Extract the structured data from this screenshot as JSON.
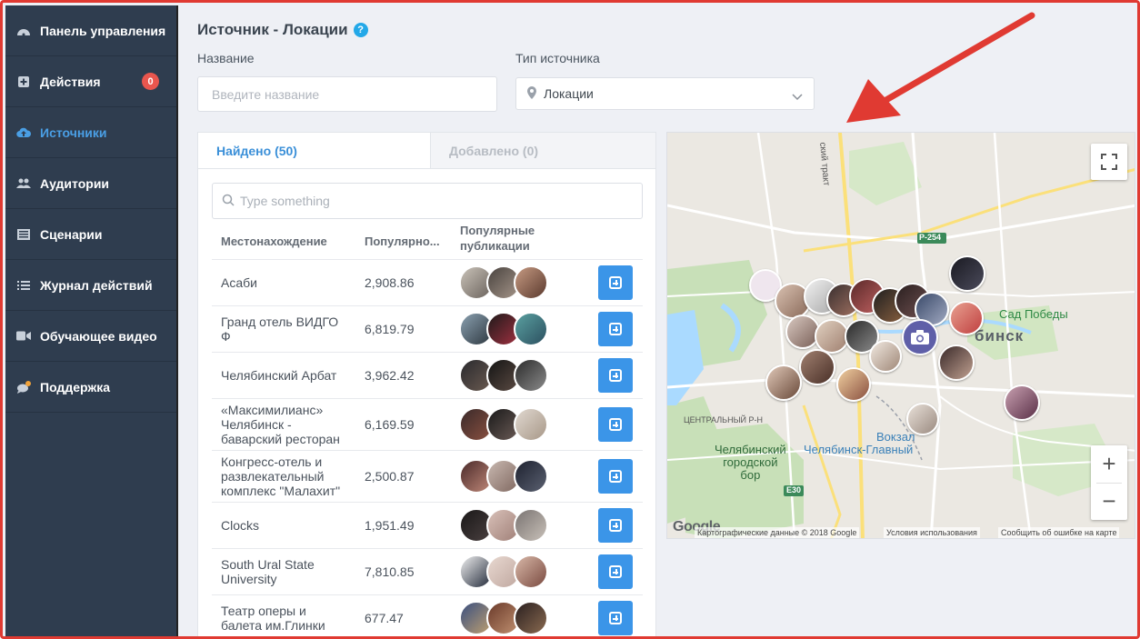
{
  "sidebar": {
    "items": [
      {
        "label": "Панель управления",
        "icon": "dashboard-icon"
      },
      {
        "label": "Действия",
        "icon": "plus-square-icon",
        "badge": "0"
      },
      {
        "label": "Источники",
        "icon": "cloud-upload-icon",
        "active": true
      },
      {
        "label": "Аудитории",
        "icon": "users-icon"
      },
      {
        "label": "Сценарии",
        "icon": "list-alt-icon"
      },
      {
        "label": "Журнал действий",
        "icon": "list-icon"
      },
      {
        "label": "Обучающее видео",
        "icon": "video-icon"
      },
      {
        "label": "Поддержка",
        "icon": "chat-icon"
      }
    ]
  },
  "header": {
    "title": "Источник - Локации",
    "help": "?"
  },
  "form": {
    "name_label": "Название",
    "name_placeholder": "Введите название",
    "source_type_label": "Тип источника",
    "source_type_value": "Локации"
  },
  "tabs": {
    "found": "Найдено (50)",
    "added": "Добавлено (0)"
  },
  "search": {
    "placeholder": "Type something"
  },
  "table": {
    "col_location": "Местонахождение",
    "col_popularity": "Популярно...",
    "col_posts_line1": "Популярные",
    "col_posts_line2": "публикации",
    "rows": [
      {
        "location": "Асаби",
        "popularity": "2,908.86"
      },
      {
        "location": "Гранд отель ВИДГО Ф",
        "popularity": "6,819.79"
      },
      {
        "location": "Челябинский Арбат",
        "popularity": "3,962.42"
      },
      {
        "location": "«Максимилианс» Челябинск - баварский ресторан",
        "popularity": "6,169.59"
      },
      {
        "location": "Конгресс-отель и развлекательный комплекс \"Малахит\"",
        "popularity": "2,500.87"
      },
      {
        "location": "Clocks",
        "popularity": "1,951.49"
      },
      {
        "location": "South Ural State University",
        "popularity": "7,810.85"
      },
      {
        "location": "Театр оперы и балета им.Глинки",
        "popularity": "677.47"
      }
    ]
  },
  "map": {
    "labels": {
      "sad_pobedy": "Сад Победы",
      "city_suffix": "бинск",
      "central": "ЦЕНТРАЛЬНЫЙ Р-Н",
      "bor_line1": "Челябинский",
      "bor_line2": "городской",
      "bor_line3": "бор",
      "vokzal": "Вокзал",
      "station": "Челябинск-Главный",
      "road_p254": "Р-254",
      "road_e30": "E30",
      "trakt": "ский тракт"
    },
    "google": "Google",
    "attribution": "Картографические данные © 2018 Google",
    "terms": "Условия использования",
    "report": "Сообщить об ошибке на карте",
    "zoom_in": "+",
    "zoom_out": "−"
  },
  "colors": {
    "sidebar_bg": "#2f3d4f",
    "accent": "#3b95e8",
    "badge": "#e9564e",
    "arrow": "#e03a32"
  }
}
